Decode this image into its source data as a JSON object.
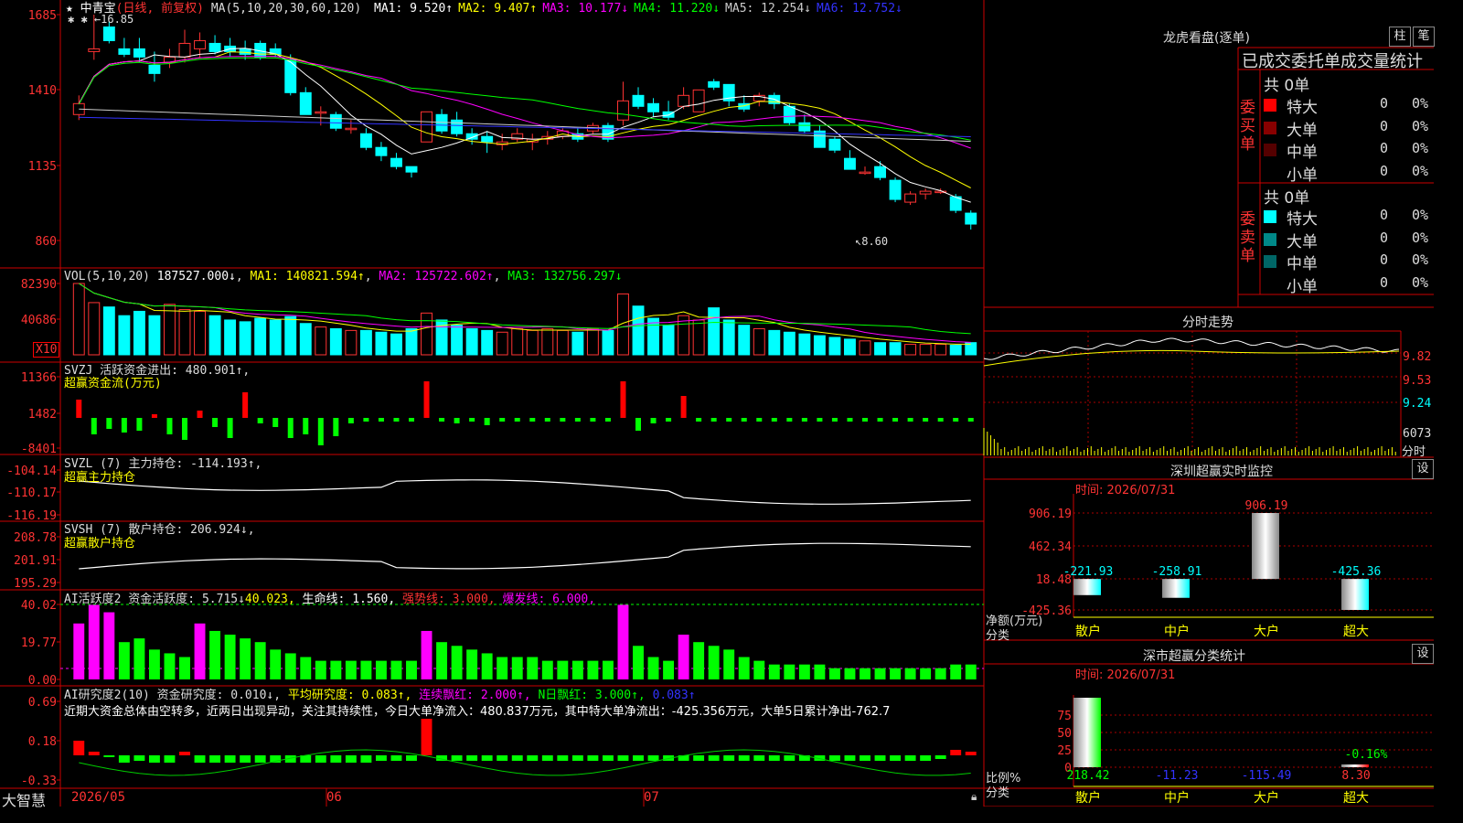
{
  "app": {
    "brand": "大智慧"
  },
  "main": {
    "stock_name": "中青宝",
    "period": "(日线, 前复权)",
    "ma_params": "MA(5,10,20,30,60,120)",
    "ma_values": [
      {
        "label": "MA1:",
        "value": "9.520↑",
        "color": "#ffffff"
      },
      {
        "label": "MA2:",
        "value": "9.407↑",
        "color": "#ffff00"
      },
      {
        "label": "MA3:",
        "value": "10.177↓",
        "color": "#ff00ff"
      },
      {
        "label": "MA4:",
        "value": "11.220↓",
        "color": "#00ff00"
      },
      {
        "label": "MA5:",
        "value": "12.254↓",
        "color": "#cccccc"
      },
      {
        "label": "MA6:",
        "value": "12.752↓",
        "color": "#3333ff"
      }
    ],
    "high_mark": "16.85",
    "low_mark": "8.60",
    "y_ticks": [
      "1685",
      "1410",
      "1135",
      "860"
    ]
  },
  "vol": {
    "header": "VOL(5,10,20)",
    "value": "187527.000↓",
    "ma1": "MA1: 140821.594↑",
    "ma2": "MA2: 125722.602↑",
    "ma3": "MA3: 132756.297↓",
    "y_ticks": [
      "82390",
      "40686"
    ],
    "unit": "X10"
  },
  "svzj": {
    "header": "SVZJ  活跃资金进出: 480.901↑,",
    "sub": "超赢资金流(万元)",
    "y_ticks": [
      "11366",
      "1482",
      "-8401"
    ]
  },
  "svzl": {
    "header": "SVZL (7) 主力持仓: -114.193↑,",
    "sub": "超赢主力持仓",
    "y_ticks": [
      "-104.14",
      "-110.17",
      "-116.19"
    ]
  },
  "svsh": {
    "header": "SVSH (7) 散户持仓: 206.924↓,",
    "sub": "超赢散户持仓",
    "y_ticks": [
      "208.78",
      "201.91",
      "195.29"
    ]
  },
  "ai_active": {
    "header": "AI活跃度2 资金活跃度: 5.715↓",
    "v2": "40.023,",
    "v3": "生命线: 1.560,",
    "v4": "强势线: 3.000,",
    "v5": "爆发线: 6.000,",
    "y_ticks": [
      "40.02",
      "19.77",
      "0.00"
    ]
  },
  "ai_research": {
    "header": "AI研究度2(10) 资金研究度: 0.010↓,",
    "v2": "平均研究度: 0.083↑,",
    "v3": "连续飘红: 2.000↑,",
    "v4": "N日飘红: 3.000↑,",
    "v5": "0.083↑",
    "comment": "近期大资金总体由空转多，近两日出现异动，关注其持续性，今日大单净流入：480.837万元，其中特大单净流出：-425.356万元，大单5日累计净出-762.7",
    "y_ticks": [
      "0.69",
      "0.18",
      "-0.33"
    ]
  },
  "x_axis": {
    "labels": [
      "2026/05",
      "06",
      "07"
    ]
  },
  "lhb": {
    "title": "龙虎看盘(逐单)",
    "btn1": "柱",
    "btn2": "笔",
    "subtitle": "已成交委托单成交量统计",
    "buy_label": "委买单",
    "sell_label": "委卖单",
    "buy_total": "共 0单",
    "sell_total": "共 0单",
    "buy_rows": [
      {
        "name": "特大",
        "count": "0",
        "pct": "0%",
        "color": "#ff0000"
      },
      {
        "name": "大单",
        "count": "0",
        "pct": "0%",
        "color": "#880000"
      },
      {
        "name": "中单",
        "count": "0",
        "pct": "0%",
        "color": "#550000"
      },
      {
        "name": "小单",
        "count": "0",
        "pct": "0%",
        "color": ""
      }
    ],
    "sell_rows": [
      {
        "name": "特大",
        "count": "0",
        "pct": "0%",
        "color": "#00ffff"
      },
      {
        "name": "大单",
        "count": "0",
        "pct": "0%",
        "color": "#008888"
      },
      {
        "name": "中单",
        "count": "0",
        "pct": "0%",
        "color": "#006666"
      },
      {
        "name": "小单",
        "count": "0",
        "pct": "0%",
        "color": ""
      }
    ]
  },
  "intraday": {
    "title": "分时走势",
    "y_ticks": [
      "9.82",
      "9.53",
      "9.24"
    ],
    "vol_label": "6073",
    "vol_unit": "分时"
  },
  "sz_monitor": {
    "title": "深圳超赢实时监控",
    "set": "设",
    "time": "时间: 2026/07/31",
    "y_label1": "净额(万元)",
    "y_label2": "分类",
    "y_ticks": [
      "906.19",
      "462.34",
      "18.48",
      "-425.36"
    ],
    "chart_data": {
      "type": "bar",
      "categories": [
        "散户",
        "中户",
        "大户",
        "超大"
      ],
      "values": [
        -221.93,
        -258.91,
        906.19,
        -425.36
      ],
      "value_labels": [
        "-221.93",
        "-258.91",
        "906.19",
        "-425.36"
      ],
      "ylim": [
        -425.36,
        906.19
      ]
    }
  },
  "sz_class": {
    "title": "深市超赢分类统计",
    "set": "设",
    "time": "时间: 2026/07/31",
    "y_label1": "比例%",
    "y_label2": "分类",
    "y_ticks": [
      "75",
      "50",
      "25",
      "0"
    ],
    "chart_data": {
      "type": "bar",
      "categories": [
        "散户",
        "中户",
        "大户",
        "超大"
      ],
      "values": [
        218.42,
        -11.23,
        -115.49,
        8.3
      ],
      "value_labels": [
        "218.42",
        "-11.23",
        "-115.49",
        "8.30"
      ],
      "bar_pct": [
        100,
        0,
        0,
        4
      ],
      "annotation": "-0.16%"
    }
  }
}
